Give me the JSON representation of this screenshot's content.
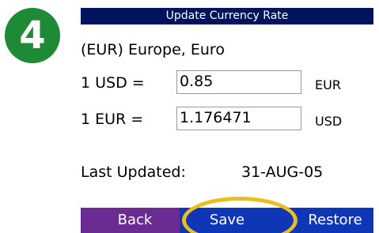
{
  "step_badge": {
    "number": "4",
    "color": "#1e8a35"
  },
  "dialog": {
    "title": "Update Currency Rate",
    "currency_name": "(EUR) Europe, Euro",
    "rates": [
      {
        "label": "1 USD =",
        "value": "0.85",
        "unit": "EUR"
      },
      {
        "label": "1 EUR =",
        "value": "1.176471",
        "unit": "USD"
      }
    ],
    "last_updated": {
      "label": "Last Updated:",
      "value": "31-AUG-05"
    }
  },
  "buttons": {
    "back": "Back",
    "save": "Save",
    "restore": "Restore"
  },
  "colors": {
    "title_bar": "#00135d",
    "back_button": "#6a2c92",
    "action_button": "#1036b8",
    "highlight": "#e9bf1f"
  },
  "highlighted_button": "save"
}
